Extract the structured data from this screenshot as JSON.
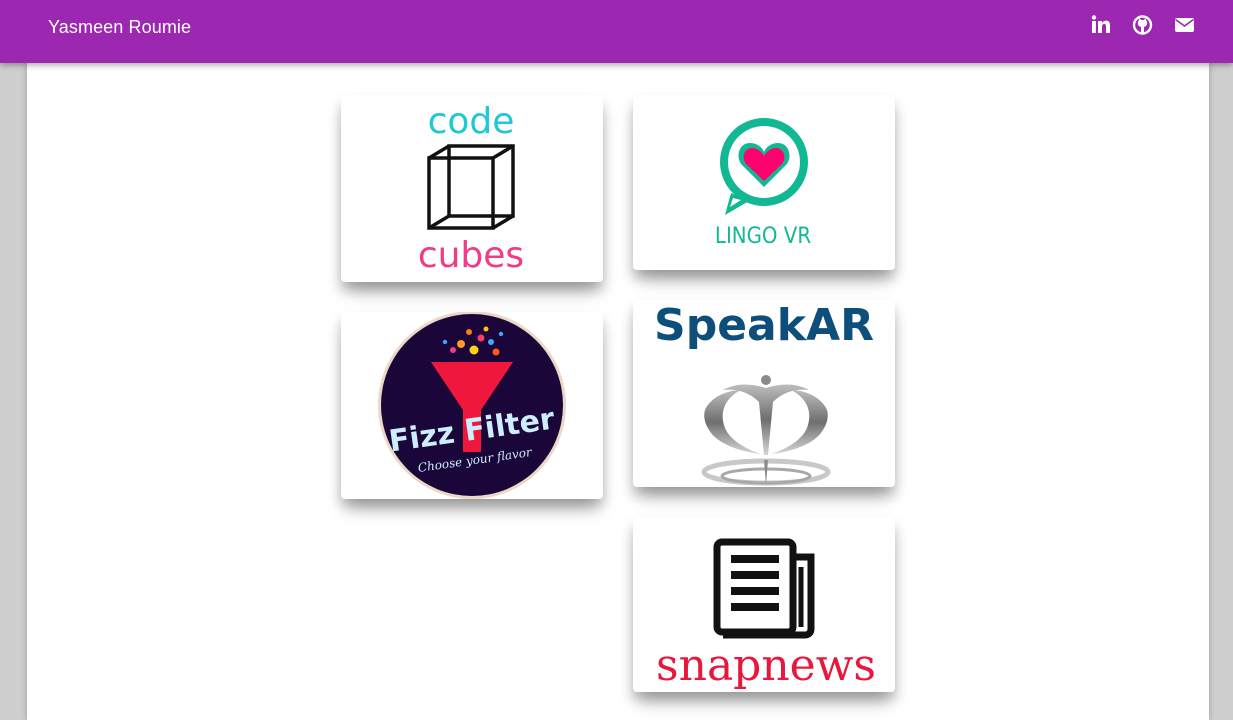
{
  "navbar": {
    "brand": "Yasmeen Roumie",
    "icons": [
      "linkedin-icon",
      "github-icon",
      "envelope-icon"
    ],
    "background": "#9c27b0"
  },
  "projects": [
    {
      "id": "code-cubes",
      "line1": "code",
      "line2": "cubes"
    },
    {
      "id": "lingo-vr",
      "label": "LINGO VR"
    },
    {
      "id": "fizz-filter",
      "title": "Fizz Filter",
      "tagline": "Choose your flavor"
    },
    {
      "id": "speakar",
      "title": "SpeakAR"
    },
    {
      "id": "snapnews",
      "title": "snapnews"
    }
  ],
  "colors": {
    "teal": "#1fc8d6",
    "pink": "#f03c86",
    "lingo_green": "#12b893",
    "heart_pink": "#ff006e",
    "speak_blue": "#0d4f7a",
    "fizz_bg": "#1a0638",
    "fizz_red": "#f0173c",
    "fizz_text": "#cdeffd",
    "snap_red": "#e8173c"
  }
}
